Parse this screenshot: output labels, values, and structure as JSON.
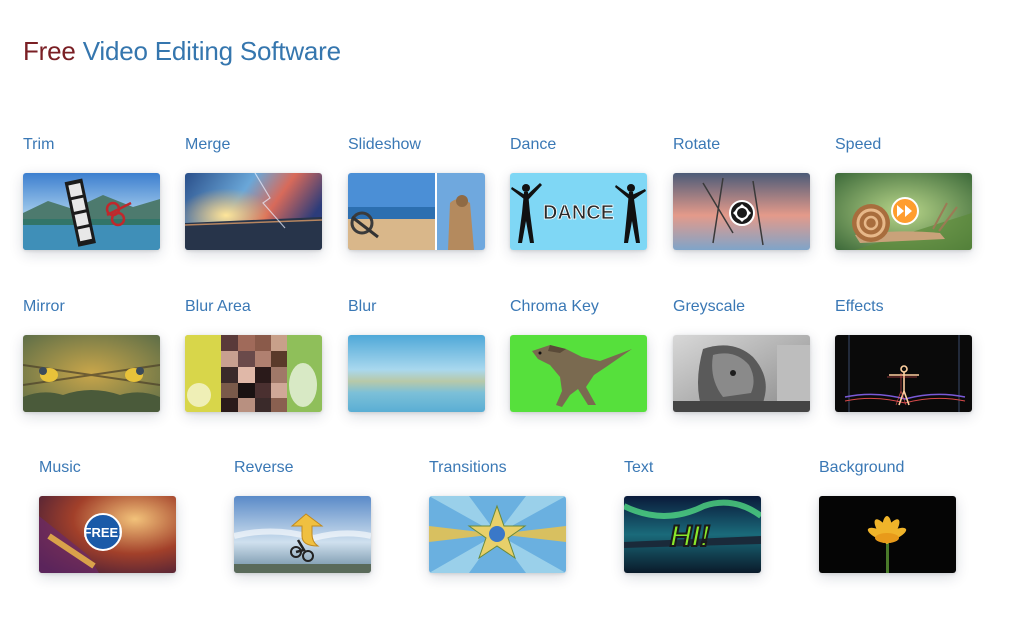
{
  "header": {
    "title_highlight": "Free",
    "title_rest": "Video Editing Software"
  },
  "tools": {
    "trim": {
      "label": "Trim"
    },
    "merge": {
      "label": "Merge"
    },
    "slideshow": {
      "label": "Slideshow"
    },
    "dance": {
      "label": "Dance",
      "thumb_text": "DANCE"
    },
    "rotate": {
      "label": "Rotate"
    },
    "speed": {
      "label": "Speed"
    },
    "mirror": {
      "label": "Mirror"
    },
    "blur_area": {
      "label": "Blur Area"
    },
    "blur": {
      "label": "Blur"
    },
    "chroma_key": {
      "label": "Chroma Key"
    },
    "greyscale": {
      "label": "Greyscale"
    },
    "effects": {
      "label": "Effects"
    },
    "music": {
      "label": "Music",
      "thumb_text": "FREE!"
    },
    "reverse": {
      "label": "Reverse"
    },
    "transitions": {
      "label": "Transitions"
    },
    "text": {
      "label": "Text",
      "thumb_text": "HI!"
    },
    "background": {
      "label": "Background"
    }
  },
  "colors": {
    "title_highlight": "#7a1f24",
    "title_rest": "#3576ae",
    "link": "#3a78b5",
    "chroma_green": "#56e03c",
    "dance_bg": "#7fd7f5"
  }
}
